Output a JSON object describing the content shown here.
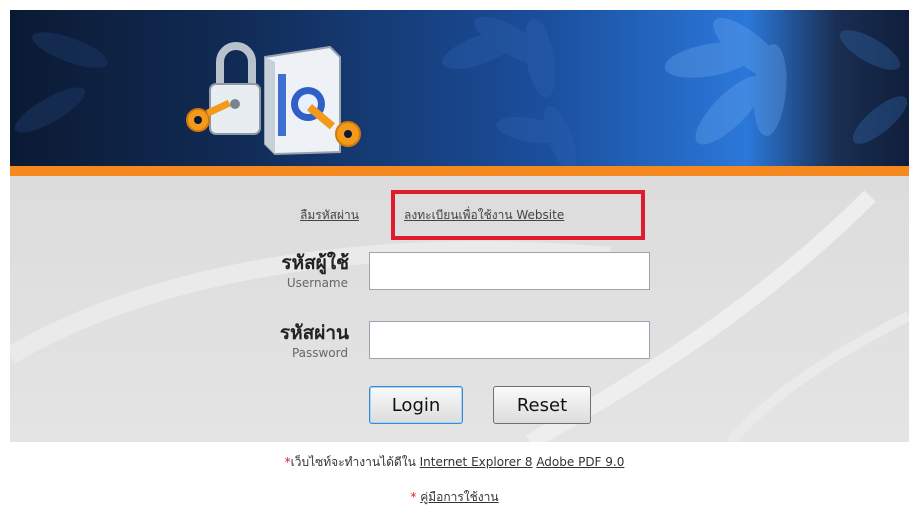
{
  "header": {
    "logo_icon": "padlock-and-keys-logo",
    "colors": {
      "banner_dark": "#0b1a33",
      "banner_blue": "#2b78da",
      "accent_orange": "#f5881f"
    }
  },
  "links": {
    "forgot_password": "ลืมรหัสผ่าน",
    "register": "ลงทะเบียนเพื่อใช้งาน Website"
  },
  "form": {
    "username_label_th": "รหัสผู้ใช้",
    "username_label_en": "Username",
    "username_value": "",
    "password_label_th": "รหัสผ่าน",
    "password_label_en": "Password",
    "password_value": "",
    "login_label": "Login",
    "reset_label": "Reset"
  },
  "notes": {
    "compat_star": "*",
    "compat_text": "เว็บไซท์จะทำงานได้ดีใน",
    "browser_link": "Internet Explorer 8",
    "pdf_link": "Adobe PDF 9.0",
    "manual_star": "*",
    "manual_link": "คู่มือการใช้งาน"
  },
  "highlight": {
    "color": "#e01b2d"
  }
}
